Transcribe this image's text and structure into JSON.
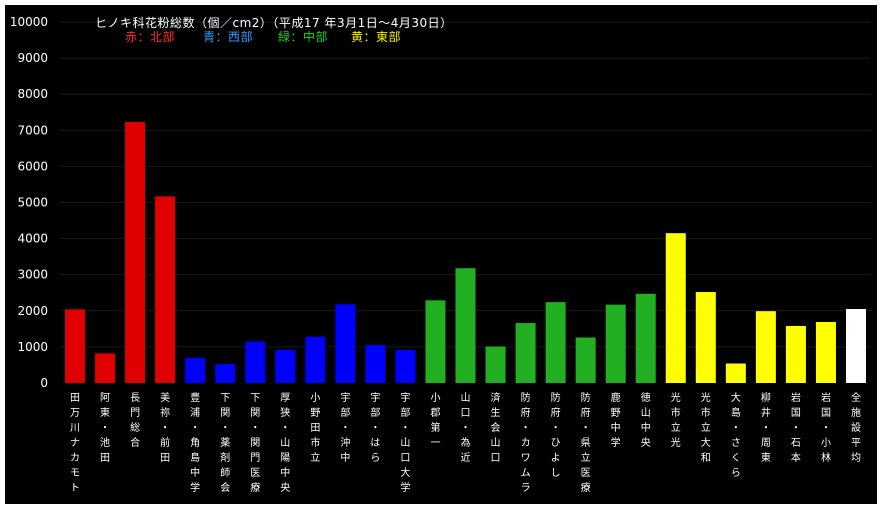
{
  "chart_data": {
    "type": "bar",
    "title": "ヒノキ科花粉総数（個／cm2）（平成17 年3月1日〜4月30日）",
    "legend": [
      {
        "label": "赤：北部",
        "color": "#ff2a2a"
      },
      {
        "label": "青：西部",
        "color": "#2f9cff"
      },
      {
        "label": "緑：中部",
        "color": "#22cc22"
      },
      {
        "label": "黄：東部",
        "color": "#ffee00"
      }
    ],
    "ylim": [
      0,
      10000
    ],
    "yticks": [
      "0",
      "1000",
      "2000",
      "3000",
      "4000",
      "5000",
      "6000",
      "7000",
      "8000",
      "9000",
      "10000"
    ],
    "grid": true,
    "categories": [
      "田万川ナカモト",
      "阿東・池田",
      "長門総合",
      "美祢・前田",
      "豊浦・角島中学",
      "下関・薬剤師会",
      "下関・関門医療",
      "厚狭・山陽中央",
      "小野田市立",
      "宇部・沖中",
      "宇部・はら",
      "宇部・山口大学",
      "小郡第一",
      "山口・為近",
      "済生会山口",
      "防府・カワムラ",
      "防府・ひよし",
      "防府・県立医療",
      "鹿野中学",
      "徳山中央",
      "光市立光",
      "光市立大和",
      "大島・さくら",
      "柳井・周東",
      "岩国・石本",
      "岩国・小林",
      "全施設平均"
    ],
    "values": [
      2040,
      820,
      7230,
      5170,
      700,
      530,
      1150,
      920,
      1280,
      2180,
      1050,
      920,
      2290,
      3180,
      1010,
      1660,
      2240,
      1260,
      2170,
      2470,
      4150,
      2520,
      540,
      1990,
      1580,
      1690,
      2050
    ],
    "bar_colors": [
      "#e00000",
      "#e00000",
      "#e00000",
      "#e00000",
      "#0000ff",
      "#0000ff",
      "#0000ff",
      "#0000ff",
      "#0000ff",
      "#0000ff",
      "#0000ff",
      "#0000ff",
      "#22b022",
      "#22b022",
      "#22b022",
      "#22b022",
      "#22b022",
      "#22b022",
      "#22b022",
      "#22b022",
      "#ffff00",
      "#ffff00",
      "#ffff00",
      "#ffff00",
      "#ffff00",
      "#ffff00",
      "#ffffff"
    ]
  },
  "colors": {
    "background": "#000000",
    "axis_text": "#ffffff",
    "grid": "#1a1a1a"
  }
}
